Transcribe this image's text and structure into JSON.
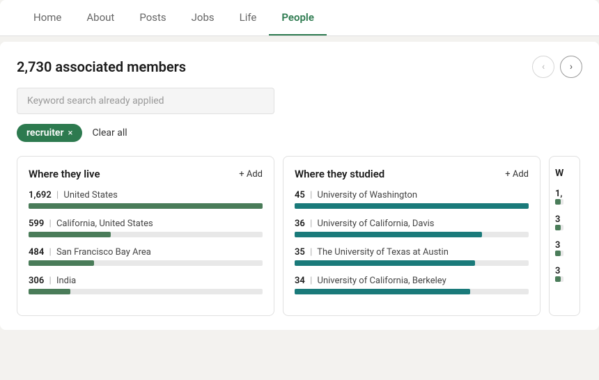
{
  "nav": {
    "items": [
      {
        "label": "Home",
        "active": false
      },
      {
        "label": "About",
        "active": false
      },
      {
        "label": "Posts",
        "active": false
      },
      {
        "label": "Jobs",
        "active": false
      },
      {
        "label": "Life",
        "active": false
      },
      {
        "label": "People",
        "active": true
      }
    ]
  },
  "members": {
    "count_label": "2,730 associated members",
    "search_placeholder": "Keyword search already applied"
  },
  "filter_tag": {
    "label": "recruiter",
    "x": "×"
  },
  "clear_all_label": "Clear all",
  "add_label": "+ Add",
  "where_they_live": {
    "title": "Where they live",
    "items": [
      {
        "count": "1,692",
        "label": "United States",
        "pct": 100
      },
      {
        "count": "599",
        "label": "California, United States",
        "pct": 35
      },
      {
        "count": "484",
        "label": "San Francisco Bay Area",
        "pct": 28
      },
      {
        "count": "306",
        "label": "India",
        "pct": 18
      }
    ]
  },
  "where_they_studied": {
    "title": "Where they studied",
    "items": [
      {
        "count": "45",
        "label": "University of Washington",
        "pct": 100
      },
      {
        "count": "36",
        "label": "University of California, Davis",
        "pct": 80
      },
      {
        "count": "35",
        "label": "The University of Texas at Austin",
        "pct": 77
      },
      {
        "count": "34",
        "label": "University of California, Berkeley",
        "pct": 75
      }
    ]
  },
  "partial_card": {
    "title": "W",
    "items": [
      {
        "count": "1,"
      },
      {
        "count": "3"
      },
      {
        "count": "3"
      },
      {
        "count": "3"
      }
    ]
  },
  "arrows": {
    "left": "‹",
    "right": "›"
  }
}
